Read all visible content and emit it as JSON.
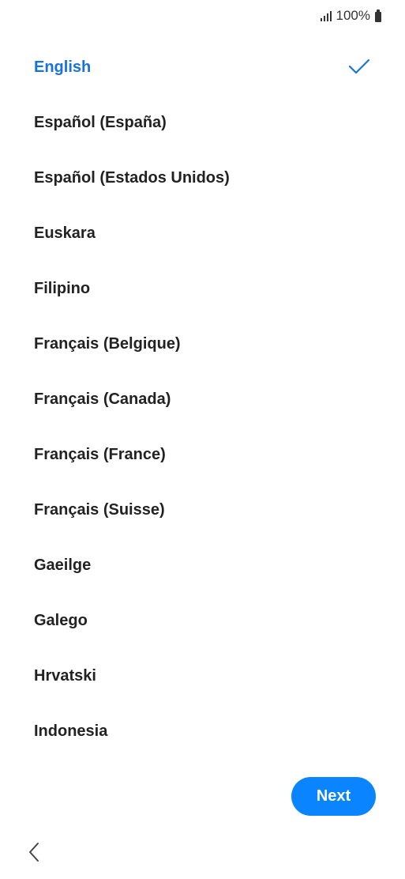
{
  "status_bar": {
    "battery_text": "100%",
    "icons": [
      "signal-icon",
      "battery-icon"
    ]
  },
  "languages": [
    {
      "label": "English",
      "selected": true
    },
    {
      "label": "Español (España)",
      "selected": false
    },
    {
      "label": "Español (Estados Unidos)",
      "selected": false
    },
    {
      "label": "Euskara",
      "selected": false
    },
    {
      "label": "Filipino",
      "selected": false
    },
    {
      "label": "Français (Belgique)",
      "selected": false
    },
    {
      "label": "Français (Canada)",
      "selected": false
    },
    {
      "label": "Français (France)",
      "selected": false
    },
    {
      "label": "Français (Suisse)",
      "selected": false
    },
    {
      "label": "Gaeilge",
      "selected": false
    },
    {
      "label": "Galego",
      "selected": false
    },
    {
      "label": "Hrvatski",
      "selected": false
    },
    {
      "label": "Indonesia",
      "selected": false
    }
  ],
  "next_button": {
    "label": "Next"
  },
  "navigation": {
    "back_icon": "chevron-left-icon"
  },
  "colors": {
    "accent": "#0a84ff",
    "selected_text": "#1a73d9",
    "text": "#222222",
    "background": "#ffffff"
  }
}
